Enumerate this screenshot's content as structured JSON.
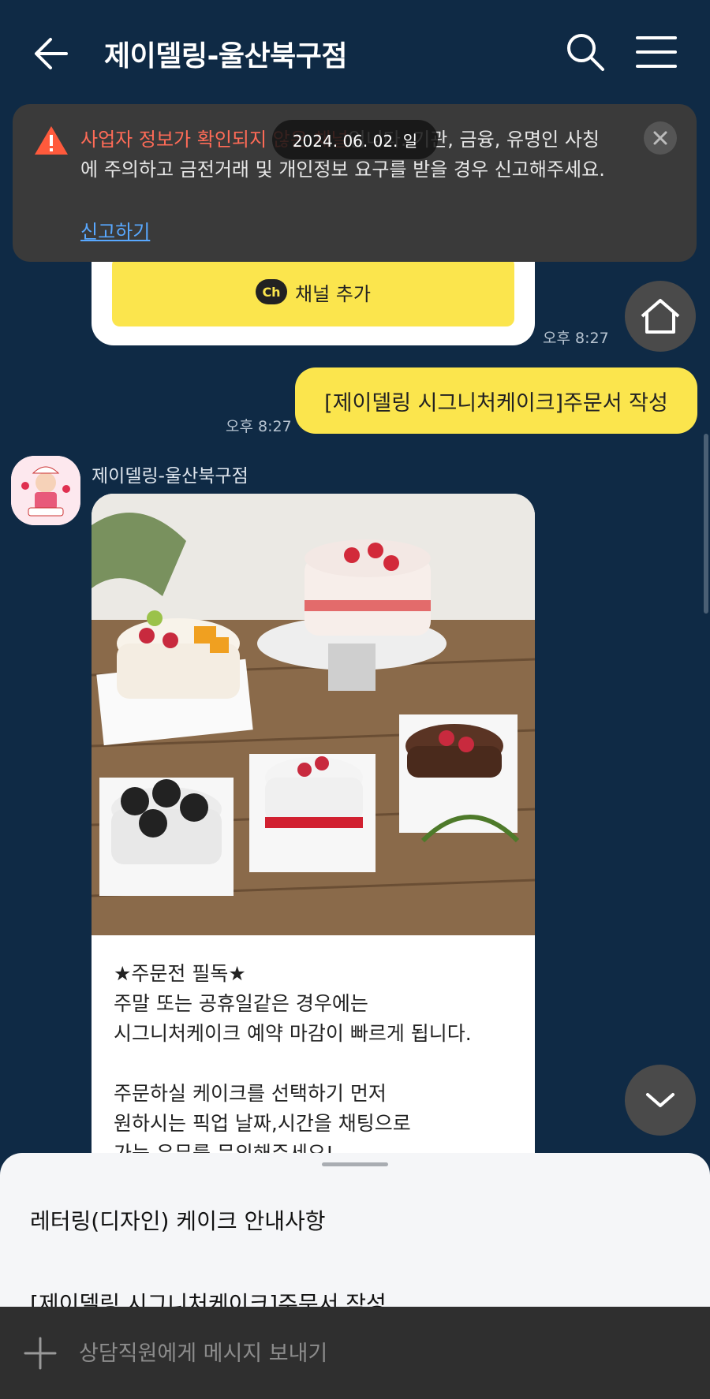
{
  "header": {
    "title": "제이델링-울산북구점"
  },
  "warning": {
    "prefix": "사업자 정보가 확인되지 않은 채널",
    "rest": "입니다. 기관, 금융, 유명인 사칭에 주의하고 금전거래 및 개인정보 요구를 받을 경우 신고해주세요.",
    "report_link": "신고하기"
  },
  "date_chip": "2024. 06. 02. 일",
  "channel_card": {
    "add_button_label": "채널 추가",
    "ch_badge": "Ch",
    "time": "오후 8:27"
  },
  "my_message": {
    "text": "[제이델링 시그니처케이크]주문서 작성",
    "time": "오후 8:27"
  },
  "incoming": {
    "sender": "제이델링-울산북구점",
    "text": "★주문전 필독★\n주말 또는 공휴일같은 경우에는\n시그니처케이크 예약 마감이 빠르게 됩니다.\n\n주문하실 케이크를 선택하기 먼저\n원하시는 픽업 날짜,시간을 채팅으로\n가능 유무를 문의해주세요!"
  },
  "bottom_sheet": {
    "items": [
      {
        "label": "레터링(디자인) 케이크 안내사항"
      },
      {
        "label": "[제이델링 시그니처케이크]주문서 작성"
      }
    ]
  },
  "input": {
    "placeholder": "상담직원에게 메시지 보내기"
  },
  "colors": {
    "background": "#0f2a45",
    "accent_yellow": "#fbe54d",
    "warning_red": "#ff6b57",
    "link_blue": "#58a8ff"
  }
}
